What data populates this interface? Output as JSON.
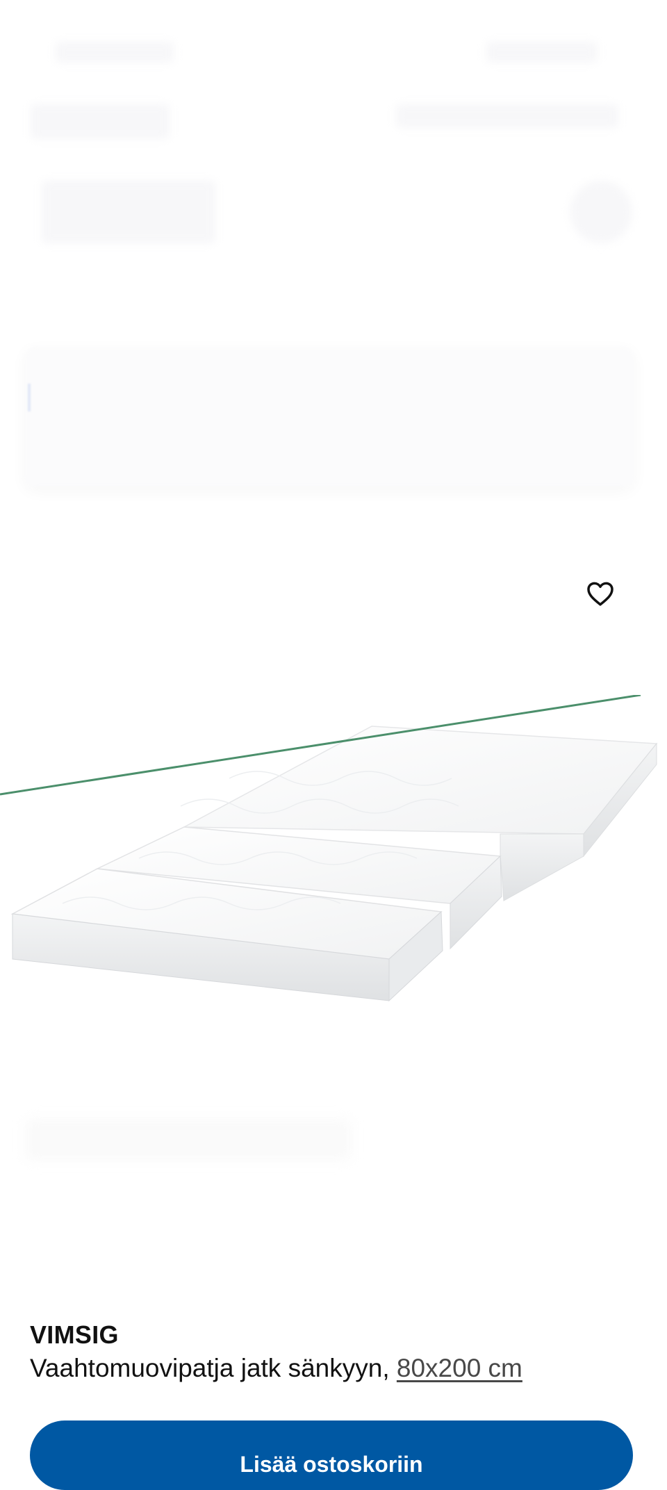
{
  "product": {
    "name": "VIMSIG",
    "description": "Vaahtomuovipatja jatk sänkyyn,",
    "size": "80x200 cm"
  },
  "actions": {
    "add_to_cart_label": "Lisää ostoskoriin",
    "wishlist_icon": "heart-outline-icon"
  },
  "colors": {
    "primary_button": "#0058a3",
    "text": "#111111"
  }
}
